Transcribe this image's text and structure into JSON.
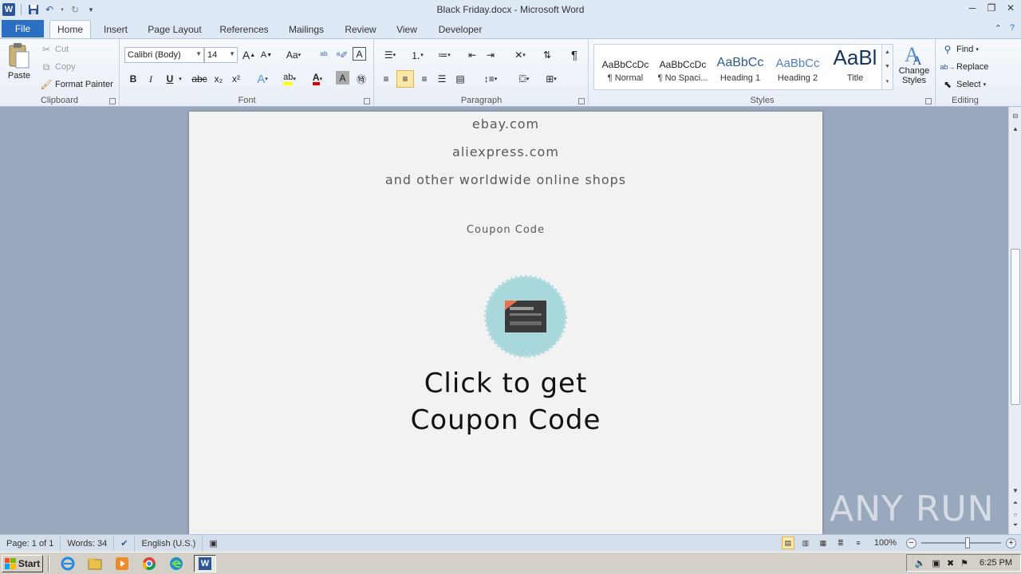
{
  "window": {
    "title": "Black Friday.docx - Microsoft Word"
  },
  "ribbon_tabs": {
    "file": "File",
    "items": [
      "Home",
      "Insert",
      "Page Layout",
      "References",
      "Mailings",
      "Review",
      "View",
      "Developer"
    ],
    "active": "Home"
  },
  "clipboard": {
    "paste": "Paste",
    "cut": "Cut",
    "copy": "Copy",
    "format_painter": "Format Painter",
    "label": "Clipboard"
  },
  "font": {
    "name": "Calibri (Body)",
    "size": "14",
    "label": "Font",
    "grow": "A",
    "shrink": "A",
    "change_case": "Aa",
    "bold": "B",
    "italic": "I",
    "underline": "U",
    "strike": "abc",
    "subscript": "x₂",
    "superscript": "x²",
    "font_color": "A",
    "char_shade": "A"
  },
  "paragraph": {
    "label": "Paragraph",
    "pilcrow": "¶"
  },
  "styles": {
    "label": "Styles",
    "items": [
      {
        "preview": "AaBbCcDc",
        "name": "¶ Normal"
      },
      {
        "preview": "AaBbCcDc",
        "name": "¶ No Spaci..."
      },
      {
        "preview": "AaBbCc",
        "name": "Heading 1"
      },
      {
        "preview": "AaBbCc",
        "name": "Heading 2"
      },
      {
        "preview": "AaBl",
        "name": "Title"
      }
    ],
    "change_styles": "Change Styles"
  },
  "editing": {
    "label": "Editing",
    "find": "Find",
    "replace": "Replace",
    "select": "Select"
  },
  "document": {
    "line1": "ebay.com",
    "line2": "aliexpress.com",
    "line3": "and other worldwide online shops",
    "coupon_caption": "Coupon Code",
    "cta_line1": "Click to get",
    "cta_line2": "Coupon Code"
  },
  "status": {
    "page": "Page: 1 of 1",
    "words": "Words: 34",
    "language": "English (U.S.)",
    "zoom": "100%"
  },
  "taskbar": {
    "start": "Start",
    "time": "6:25 PM"
  },
  "watermark": "ANY RUN",
  "colors": {
    "file_tab": "#2b6fc2",
    "word_blue": "#2b579a",
    "page_bg": "#f2f2f2",
    "workspace": "#9aa8bd",
    "badge_teal": "#a8d8dc"
  }
}
